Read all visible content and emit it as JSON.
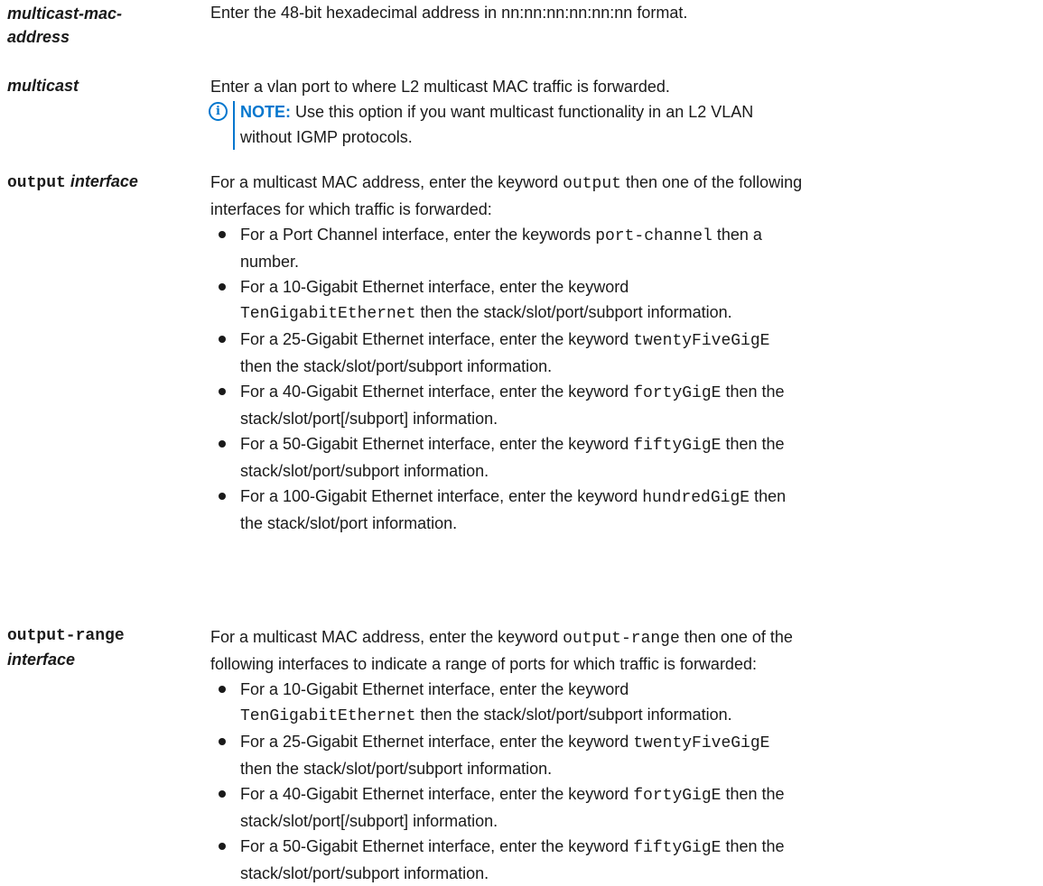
{
  "entries": [
    {
      "term": "multicast-mac-address",
      "term_line1": "multicast-mac-",
      "term_line2": "address",
      "description": "Enter the 48-bit hexadecimal address in nn:nn:nn:nn:nn:nn format."
    },
    {
      "term": "multicast",
      "description": "Enter a vlan port to where L2 multicast MAC traffic is forwarded.",
      "note": {
        "label": "NOTE:",
        "text_line1": " Use this option if you want multicast functionality in an L2 VLAN",
        "text_line2": "without IGMP protocols.",
        "icon": "info-icon"
      }
    },
    {
      "term_keyword": "output",
      "term_param": "interface",
      "intro_a": "For a multicast MAC address, enter the keyword ",
      "intro_kw": "output",
      "intro_b": " then one of the following",
      "intro_line2": "interfaces for which traffic is forwarded:",
      "bullets": [
        {
          "l1a": "For a Port Channel interface, enter the keywords ",
          "kw": "port-channel",
          "l1b": " then a",
          "l2": "number."
        },
        {
          "l1a": "For a 10-Gigabit Ethernet interface, enter the keyword",
          "kw": "TenGigabitEthernet",
          "l2": " then the stack/slot/port/subport information."
        },
        {
          "l1a": "For a 25-Gigabit Ethernet interface, enter the keyword ",
          "kw": "twentyFiveGigE",
          "l2": "then the stack/slot/port/subport information."
        },
        {
          "l1a": "For a 40-Gigabit Ethernet interface, enter the keyword ",
          "kw": "fortyGigE",
          "l1b": " then the",
          "l2": "stack/slot/port[/subport] information."
        },
        {
          "l1a": "For a 50-Gigabit Ethernet interface, enter the keyword ",
          "kw": "fiftyGigE",
          "l1b": " then the",
          "l2": "stack/slot/port/subport information."
        },
        {
          "l1a": "For a 100-Gigabit Ethernet interface, enter the keyword ",
          "kw": "hundredGigE",
          "l1b": " then",
          "l2": "the stack/slot/port information."
        }
      ]
    },
    {
      "term_keyword": "output-range",
      "term_param": "interface",
      "intro_a": "For a multicast MAC address, enter the keyword ",
      "intro_kw": "output-range",
      "intro_b": " then one of the",
      "intro_line2": "following interfaces to indicate a range of ports for which traffic is forwarded:",
      "bullets": [
        {
          "l1a": "For a 10-Gigabit Ethernet interface, enter the keyword",
          "kw": "TenGigabitEthernet",
          "l2": " then the stack/slot/port/subport information."
        },
        {
          "l1a": "For a 25-Gigabit Ethernet interface, enter the keyword ",
          "kw": "twentyFiveGigE",
          "l2": "then the stack/slot/port/subport information."
        },
        {
          "l1a": "For a 40-Gigabit Ethernet interface, enter the keyword ",
          "kw": "fortyGigE",
          "l1b": " then the",
          "l2": "stack/slot/port[/subport] information."
        },
        {
          "l1a": "For a 50-Gigabit Ethernet interface, enter the keyword ",
          "kw": "fiftyGigE",
          "l1b": " then the",
          "l2": "stack/slot/port/subport information."
        }
      ]
    }
  ],
  "colors": {
    "accent": "#0076ce",
    "text": "#1a1a1a"
  }
}
